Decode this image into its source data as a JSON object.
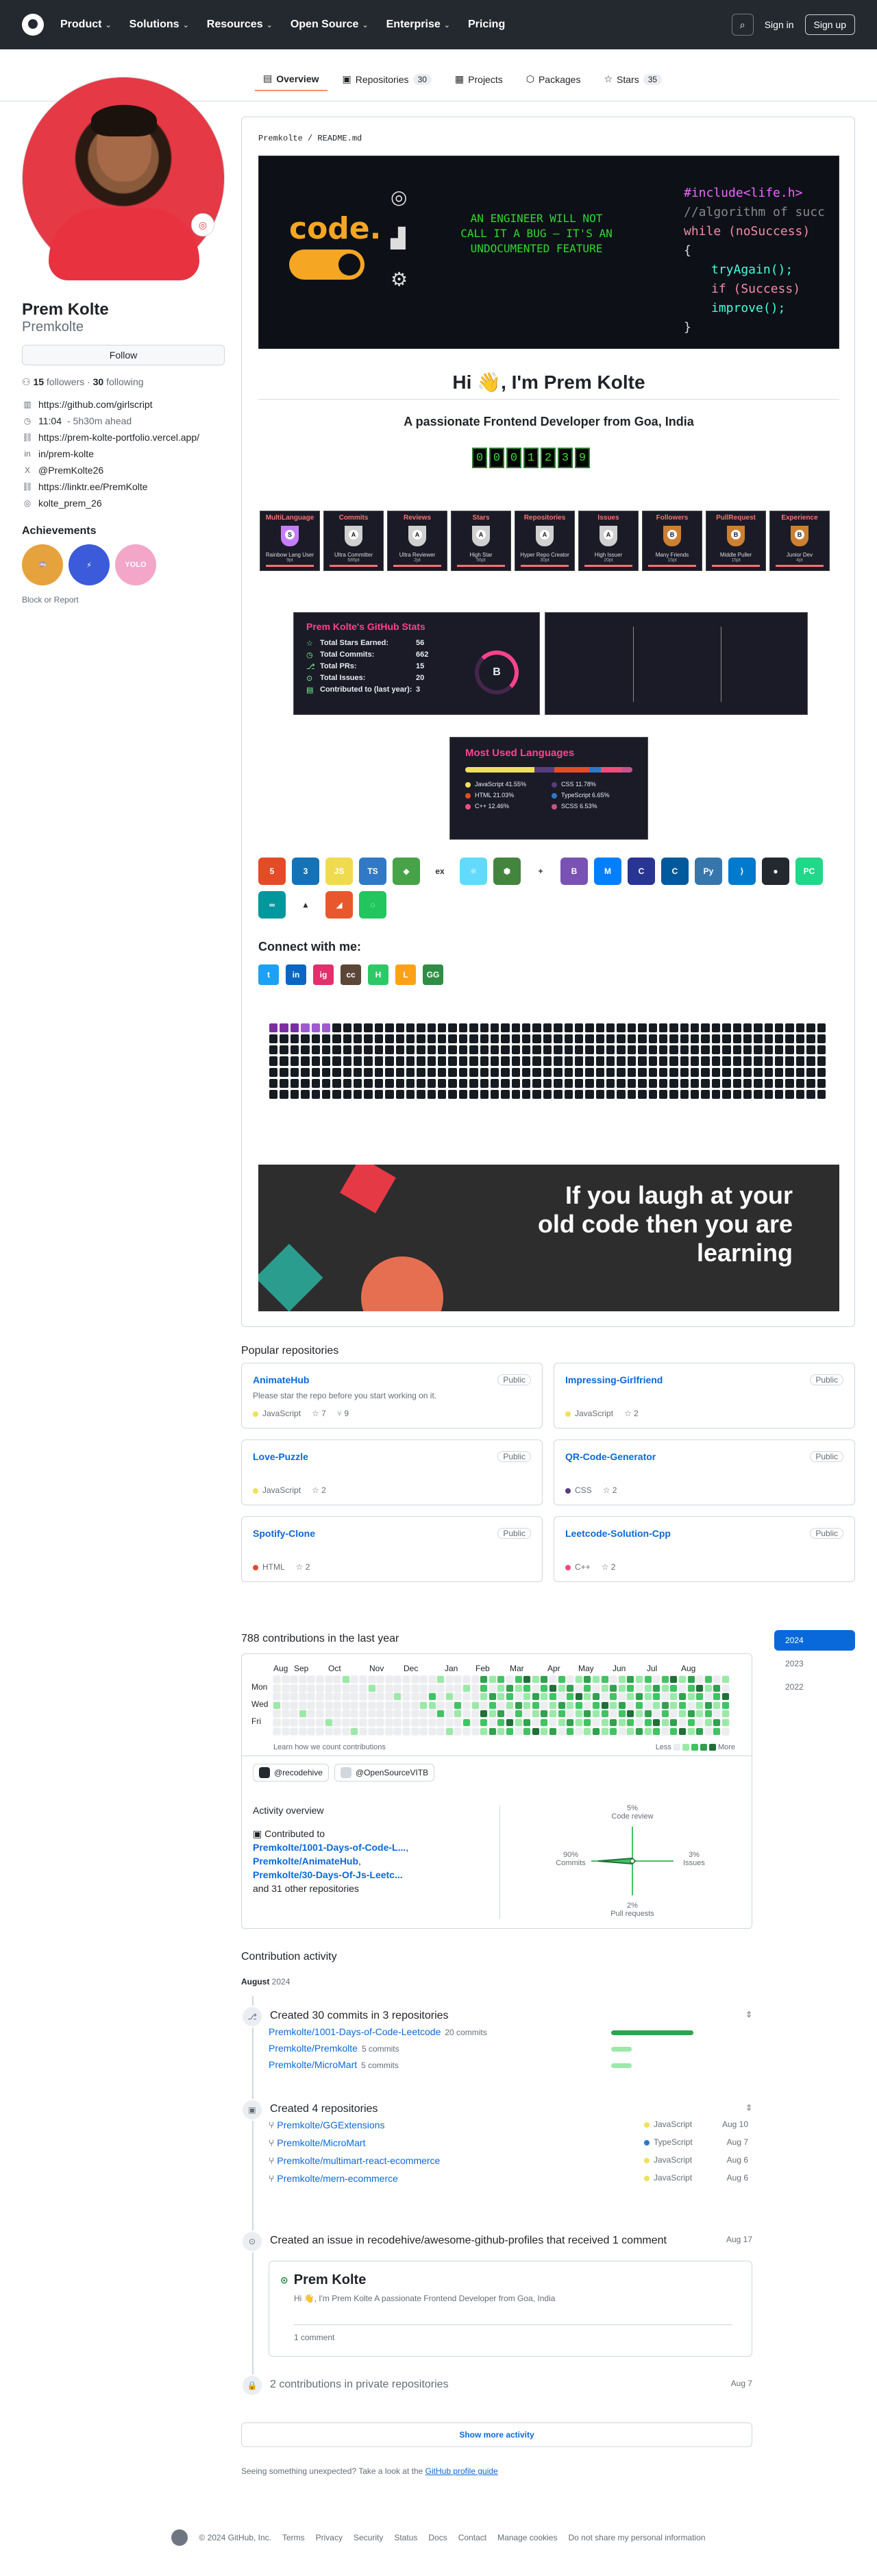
{
  "header": {
    "nav": [
      "Product",
      "Solutions",
      "Resources",
      "Open Source",
      "Enterprise",
      "Pricing"
    ],
    "sign_in": "Sign in",
    "sign_up": "Sign up"
  },
  "tabs": [
    {
      "label": "Overview"
    },
    {
      "label": "Repositories",
      "count": "30"
    },
    {
      "label": "Projects"
    },
    {
      "label": "Packages"
    },
    {
      "label": "Stars",
      "count": "35"
    }
  ],
  "profile": {
    "name": "Prem Kolte",
    "login": "Premkolte",
    "follow": "Follow",
    "followers": "15",
    "followers_label": "followers",
    "following": "30",
    "following_label": "following",
    "dot": "·",
    "details": [
      {
        "icon": "building-icon",
        "text": "https://github.com/girlscript"
      },
      {
        "icon": "clock-icon",
        "text": "11:04",
        "sub": "- 5h30m ahead"
      },
      {
        "icon": "link-icon",
        "text": "https://prem-kolte-portfolio.vercel.app/"
      },
      {
        "icon": "linkedin-icon",
        "text": "in/prem-kolte"
      },
      {
        "icon": "x-icon",
        "text": "@PremKolte26"
      },
      {
        "icon": "link-icon",
        "text": "https://linktr.ee/PremKolte"
      },
      {
        "icon": "instagram-icon",
        "text": "kolte_prem_26"
      }
    ],
    "achievements": "Achievements",
    "report": "Block or Report"
  },
  "readme": {
    "path": "Premkolte / README.md",
    "banner": {
      "brand": "code.",
      "quote": "AN ENGINEER WILL NOT CALL IT A BUG — IT'S AN UNDOCUMENTED FEATURE",
      "code": [
        "#include<life.h>",
        "//algorithm of succ",
        "while (noSuccess)",
        "{",
        "tryAgain();",
        "if (Success)",
        "improve();",
        "}"
      ]
    },
    "title": "Hi 👋, I'm Prem Kolte",
    "subtitle": "A passionate Frontend Developer from Goa, India",
    "counter": [
      "0",
      "0",
      "0",
      "1",
      "2",
      "3",
      "9"
    ],
    "trophies": [
      {
        "t": "MultiLanguage",
        "r": "S",
        "n": "Rainbow Lang User",
        "p": "9pt"
      },
      {
        "t": "Commits",
        "r": "A",
        "n": "Ultra Committer",
        "p": "686pt"
      },
      {
        "t": "Reviews",
        "r": "A",
        "n": "Ultra Reviewer",
        "p": "2pt"
      },
      {
        "t": "Stars",
        "r": "A",
        "n": "High Star",
        "p": "56pt"
      },
      {
        "t": "Repositories",
        "r": "A",
        "n": "Hyper Repo Creator",
        "p": "30pt"
      },
      {
        "t": "Issues",
        "r": "A",
        "n": "High Issuer",
        "p": "20pt"
      },
      {
        "t": "Followers",
        "r": "B",
        "n": "Many Friends",
        "p": "15pt"
      },
      {
        "t": "PullRequest",
        "r": "B",
        "n": "Middle Puller",
        "p": "15pt"
      },
      {
        "t": "Experience",
        "r": "B",
        "n": "Junior Dev",
        "p": "4pt"
      }
    ],
    "stats": {
      "title": "Prem Kolte's GitHub Stats",
      "rows": [
        {
          "k": "Total Stars Earned:",
          "v": "56"
        },
        {
          "k": "Total Commits:",
          "v": "662"
        },
        {
          "k": "Total PRs:",
          "v": "15"
        },
        {
          "k": "Total Issues:",
          "v": "20"
        },
        {
          "k": "Contributed to (last year):",
          "v": "3"
        }
      ],
      "grade": "B"
    },
    "langs": {
      "title": "Most Used Languages",
      "items": [
        {
          "n": "JavaScript",
          "p": "41.55%",
          "c": "#f1e05a",
          "v": 41.55
        },
        {
          "n": "CSS",
          "p": "11.78%",
          "c": "#563d7c",
          "v": 11.78
        },
        {
          "n": "HTML",
          "p": "21.03%",
          "c": "#e34c26",
          "v": 21.03
        },
        {
          "n": "TypeScript",
          "p": "6.65%",
          "c": "#3178c6",
          "v": 6.65
        },
        {
          "n": "C++",
          "p": "12.46%",
          "c": "#f34b7d",
          "v": 12.46
        },
        {
          "n": "SCSS",
          "p": "6.53%",
          "c": "#c6538c",
          "v": 6.53
        }
      ]
    },
    "tech": [
      {
        "n": "html5-icon",
        "c": "#e34c26",
        "l": "5"
      },
      {
        "n": "css3-icon",
        "c": "#1572b6",
        "l": "3"
      },
      {
        "n": "javascript-icon",
        "c": "#f0db4f",
        "l": "JS"
      },
      {
        "n": "typescript-icon",
        "c": "#3178c6",
        "l": "TS"
      },
      {
        "n": "mongodb-icon",
        "c": "#47a248",
        "l": "◆"
      },
      {
        "n": "express-icon",
        "c": "#ffffff",
        "l": "ex"
      },
      {
        "n": "react-icon",
        "c": "#61dafb",
        "l": "⚛"
      },
      {
        "n": "nodejs-icon",
        "c": "#43853d",
        "l": "⬢"
      },
      {
        "n": "dotnet-icon",
        "c": "#ffffff",
        "l": "+"
      },
      {
        "n": "bootstrap-icon",
        "c": "#7952b3",
        "l": "B"
      },
      {
        "n": "mui-icon",
        "c": "#007fff",
        "l": "M"
      },
      {
        "n": "c-icon",
        "c": "#283593",
        "l": "C"
      },
      {
        "n": "cpp-icon",
        "c": "#00599c",
        "l": "C"
      },
      {
        "n": "python-icon",
        "c": "#3776ab",
        "l": "Py"
      },
      {
        "n": "vscode-icon",
        "c": "#007acc",
        "l": "⟩"
      },
      {
        "n": "github-icon",
        "c": "#24292f",
        "l": "●"
      },
      {
        "n": "pycharm-icon",
        "c": "#21d789",
        "l": "PC"
      },
      {
        "n": "arduino-icon",
        "c": "#00979d",
        "l": "∞"
      },
      {
        "n": "vercel-icon",
        "c": "#ffffff",
        "l": "▲"
      },
      {
        "n": "netlify-icon",
        "c": "#e8582c",
        "l": "◢"
      },
      {
        "n": "spinner-icon",
        "c": "#22c55e",
        "l": "◌"
      }
    ],
    "connect": "Connect with me:",
    "social": [
      {
        "n": "twitter-icon",
        "c": "#1da1f2",
        "l": "t"
      },
      {
        "n": "linkedin-icon",
        "c": "#0a66c2",
        "l": "in"
      },
      {
        "n": "instagram-icon",
        "c": "#e1306c",
        "l": "ig"
      },
      {
        "n": "codechef-icon",
        "c": "#5b4638",
        "l": "cc"
      },
      {
        "n": "hackerrank-icon",
        "c": "#2ec866",
        "l": "H"
      },
      {
        "n": "leetcode-icon",
        "c": "#ffa116",
        "l": "L"
      },
      {
        "n": "geeksforgeeks-icon",
        "c": "#2f8d46",
        "l": "GG"
      }
    ],
    "quote": [
      "If you laugh at your",
      "old code then you are",
      "learning"
    ]
  },
  "popular": {
    "title": "Popular repositories",
    "repos": [
      {
        "n": "AnimateHub",
        "pub": "Public",
        "d": "Please star the repo before you start working on it.",
        "lang": "JavaScript",
        "c": "#f1e05a",
        "stars": "7",
        "forks": "9"
      },
      {
        "n": "Impressing-Girlfriend",
        "pub": "Public",
        "d": "",
        "lang": "JavaScript",
        "c": "#f1e05a",
        "stars": "2",
        "forks": ""
      },
      {
        "n": "Love-Puzzle",
        "pub": "Public",
        "d": "",
        "lang": "JavaScript",
        "c": "#f1e05a",
        "stars": "2",
        "forks": ""
      },
      {
        "n": "QR-Code-Generator",
        "pub": "Public",
        "d": "",
        "lang": "CSS",
        "c": "#563d7c",
        "stars": "2",
        "forks": ""
      },
      {
        "n": "Spotify-Clone",
        "pub": "Public",
        "d": "",
        "lang": "HTML",
        "c": "#e34c26",
        "stars": "2",
        "forks": ""
      },
      {
        "n": "Leetcode-Solution-Cpp",
        "pub": "Public",
        "d": "",
        "lang": "C++",
        "c": "#f34b7d",
        "stars": "2",
        "forks": ""
      }
    ]
  },
  "contrib": {
    "title": "788 contributions in the last year",
    "months": [
      "Aug",
      "Sep",
      "Oct",
      "Nov",
      "Dec",
      "Jan",
      "Feb",
      "Mar",
      "Apr",
      "May",
      "Jun",
      "Jul",
      "Aug"
    ],
    "days": [
      "Mon",
      "Wed",
      "Fri"
    ],
    "learn": "Learn how we count contributions",
    "less": "Less",
    "more": "More",
    "orgs": [
      {
        "n": "@recodehive"
      },
      {
        "n": "@OpenSourceVITB"
      }
    ],
    "activity": "Activity overview",
    "contributed_to": "Contributed to",
    "repos": [
      "Premkolte/1001-Days-of-Code-L...",
      "Premkolte/AnimateHub",
      "Premkolte/30-Days-Of-Js-Leetc..."
    ],
    "others": "and 31 other repositories",
    "axes": {
      "code_review": "5%",
      "code_review_label": "Code review",
      "commits": "90%",
      "commits_label": "Commits",
      "issues": "3%",
      "issues_label": "Issues",
      "pr": "2%",
      "pr_label": "Pull requests"
    },
    "years": [
      "2024",
      "2023",
      "2022"
    ]
  },
  "activity": {
    "title": "Contribution activity",
    "month": "August",
    "year": "2024",
    "commits": {
      "title": "Created 30 commits in 3 repositories",
      "rows": [
        {
          "r": "Premkolte/1001-Days-of-Code-Leetcode",
          "c": "20 commits",
          "v": 20
        },
        {
          "r": "Premkolte/Premkolte",
          "c": "5 commits",
          "v": 5
        },
        {
          "r": "Premkolte/MicroMart",
          "c": "5 commits",
          "v": 5
        }
      ]
    },
    "created": {
      "title": "Created 4 repositories",
      "rows": [
        {
          "r": "Premkolte/GGExtensions",
          "l": "JavaScript",
          "c": "#f1e05a",
          "d": "Aug 10"
        },
        {
          "r": "Premkolte/MicroMart",
          "l": "TypeScript",
          "c": "#3178c6",
          "d": "Aug 7"
        },
        {
          "r": "Premkolte/multimart-react-ecommerce",
          "l": "JavaScript",
          "c": "#f1e05a",
          "d": "Aug 6"
        },
        {
          "r": "Premkolte/mern-ecommerce",
          "l": "JavaScript",
          "c": "#f1e05a",
          "d": "Aug 6"
        }
      ]
    },
    "issue": {
      "title": "Created an issue in recodehive/awesome-github-profiles that received 1 comment",
      "date": "Aug 17",
      "head": "Prem Kolte",
      "body": "Hi 👋, I'm Prem Kolte A passionate Frontend Developer from Goa, India",
      "comments": "1 comment"
    },
    "private": {
      "title": "2 contributions in private repositories",
      "date": "Aug 7"
    },
    "more": "Show more activity",
    "unexpected": "Seeing something unexpected? Take a look at the",
    "guide": "GitHub profile guide"
  },
  "footer": [
    "© 2024 GitHub, Inc.",
    "Terms",
    "Privacy",
    "Security",
    "Status",
    "Docs",
    "Contact",
    "Manage cookies",
    "Do not share my personal information"
  ]
}
